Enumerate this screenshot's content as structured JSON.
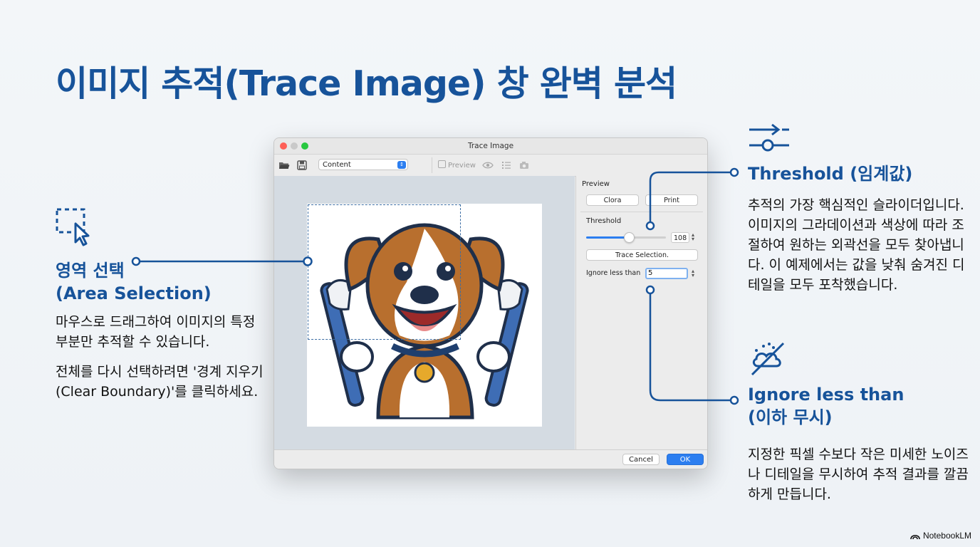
{
  "slide": {
    "title": "이미지 추적(Trace Image) 창 완벽 분석",
    "brand": "NotebookLM",
    "accent_color": "#17539a"
  },
  "callouts": {
    "area_selection": {
      "icon": "selection-cursor-icon",
      "title_line1": "영역 선택",
      "title_line2": "(Area Selection)",
      "body1": "마우스로 드래그하여 이미지의 특정 부분만 추적할 수 있습니다.",
      "body2": "전체를 다시 선택하려면 '경계 지우기(Clear Boundary)'를 클릭하세요."
    },
    "threshold": {
      "icon": "sliders-icon",
      "title": "Threshold (임계값)",
      "body": "추적의 가장 핵심적인 슬라이더입니다. 이미지의 그라데이션과 색상에 따라 조절하여 원하는 외곽선을 모두 찾아냅니다. 이 예제에서는 값을 낮춰 숨겨진 디테일을 모두 포착했습니다."
    },
    "ignore": {
      "icon": "noise-off-icon",
      "title_line1": "Ignore less than",
      "title_line2": "(이하 무시)",
      "body": "지정한 픽셀 수보다 작은 미세한 노이즈나 디테일을 무시하여 추적 결과를 깔끔하게 만듭니다."
    }
  },
  "window": {
    "title": "Trace Image",
    "toolbar": {
      "mode_select": "Content",
      "preview_label": "Preview"
    },
    "panel": {
      "preview_heading": "Preview",
      "btn_color": "Clora",
      "btn_print": "Print",
      "threshold_label": "Threshold",
      "threshold_value": "108",
      "threshold_fraction": 0.53,
      "trace_selection_button": "Trace Selection.",
      "ignore_label": "Ignore less than",
      "ignore_value": "5"
    },
    "footer": {
      "cancel": "Cancel",
      "ok": "OK"
    }
  }
}
